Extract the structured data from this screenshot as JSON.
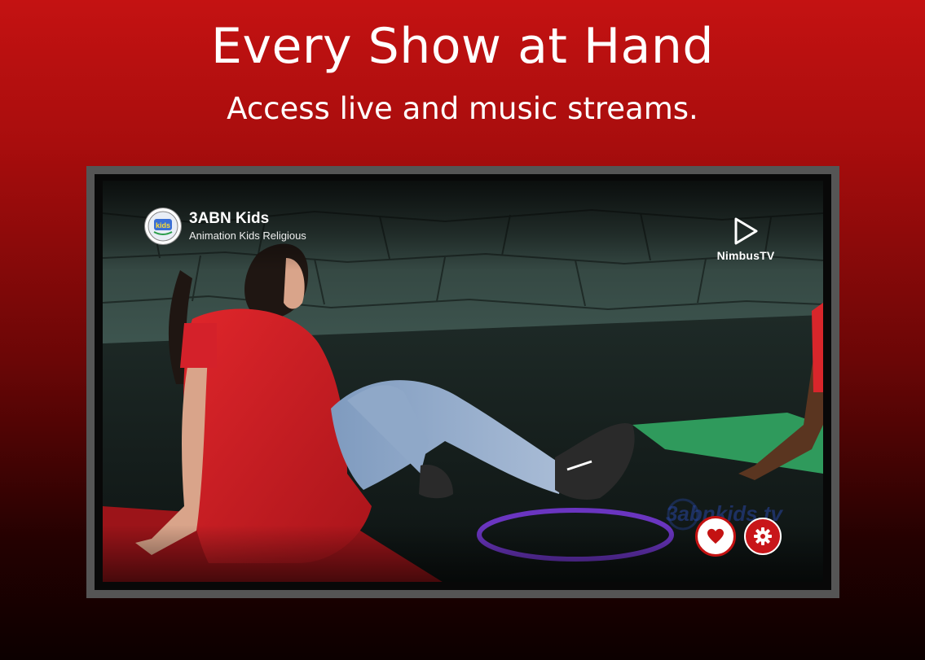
{
  "hero": {
    "title": "Every Show at Hand",
    "subtitle": "Access live and music streams."
  },
  "player": {
    "channel": {
      "name": "3ABN Kids",
      "genres": "Animation Kids Religious",
      "logo_icon": "3abn-kids-logo"
    },
    "brand": {
      "name": "NimbusTV",
      "icon": "play-outline-icon"
    },
    "watermark": "3abnkids.tv",
    "actions": {
      "favorite_icon": "heart-icon",
      "settings_icon": "gear-icon"
    }
  },
  "colors": {
    "accent": "#c41212",
    "background_top": "#c41212",
    "background_bottom": "#0c0000",
    "frame": "#555555"
  }
}
